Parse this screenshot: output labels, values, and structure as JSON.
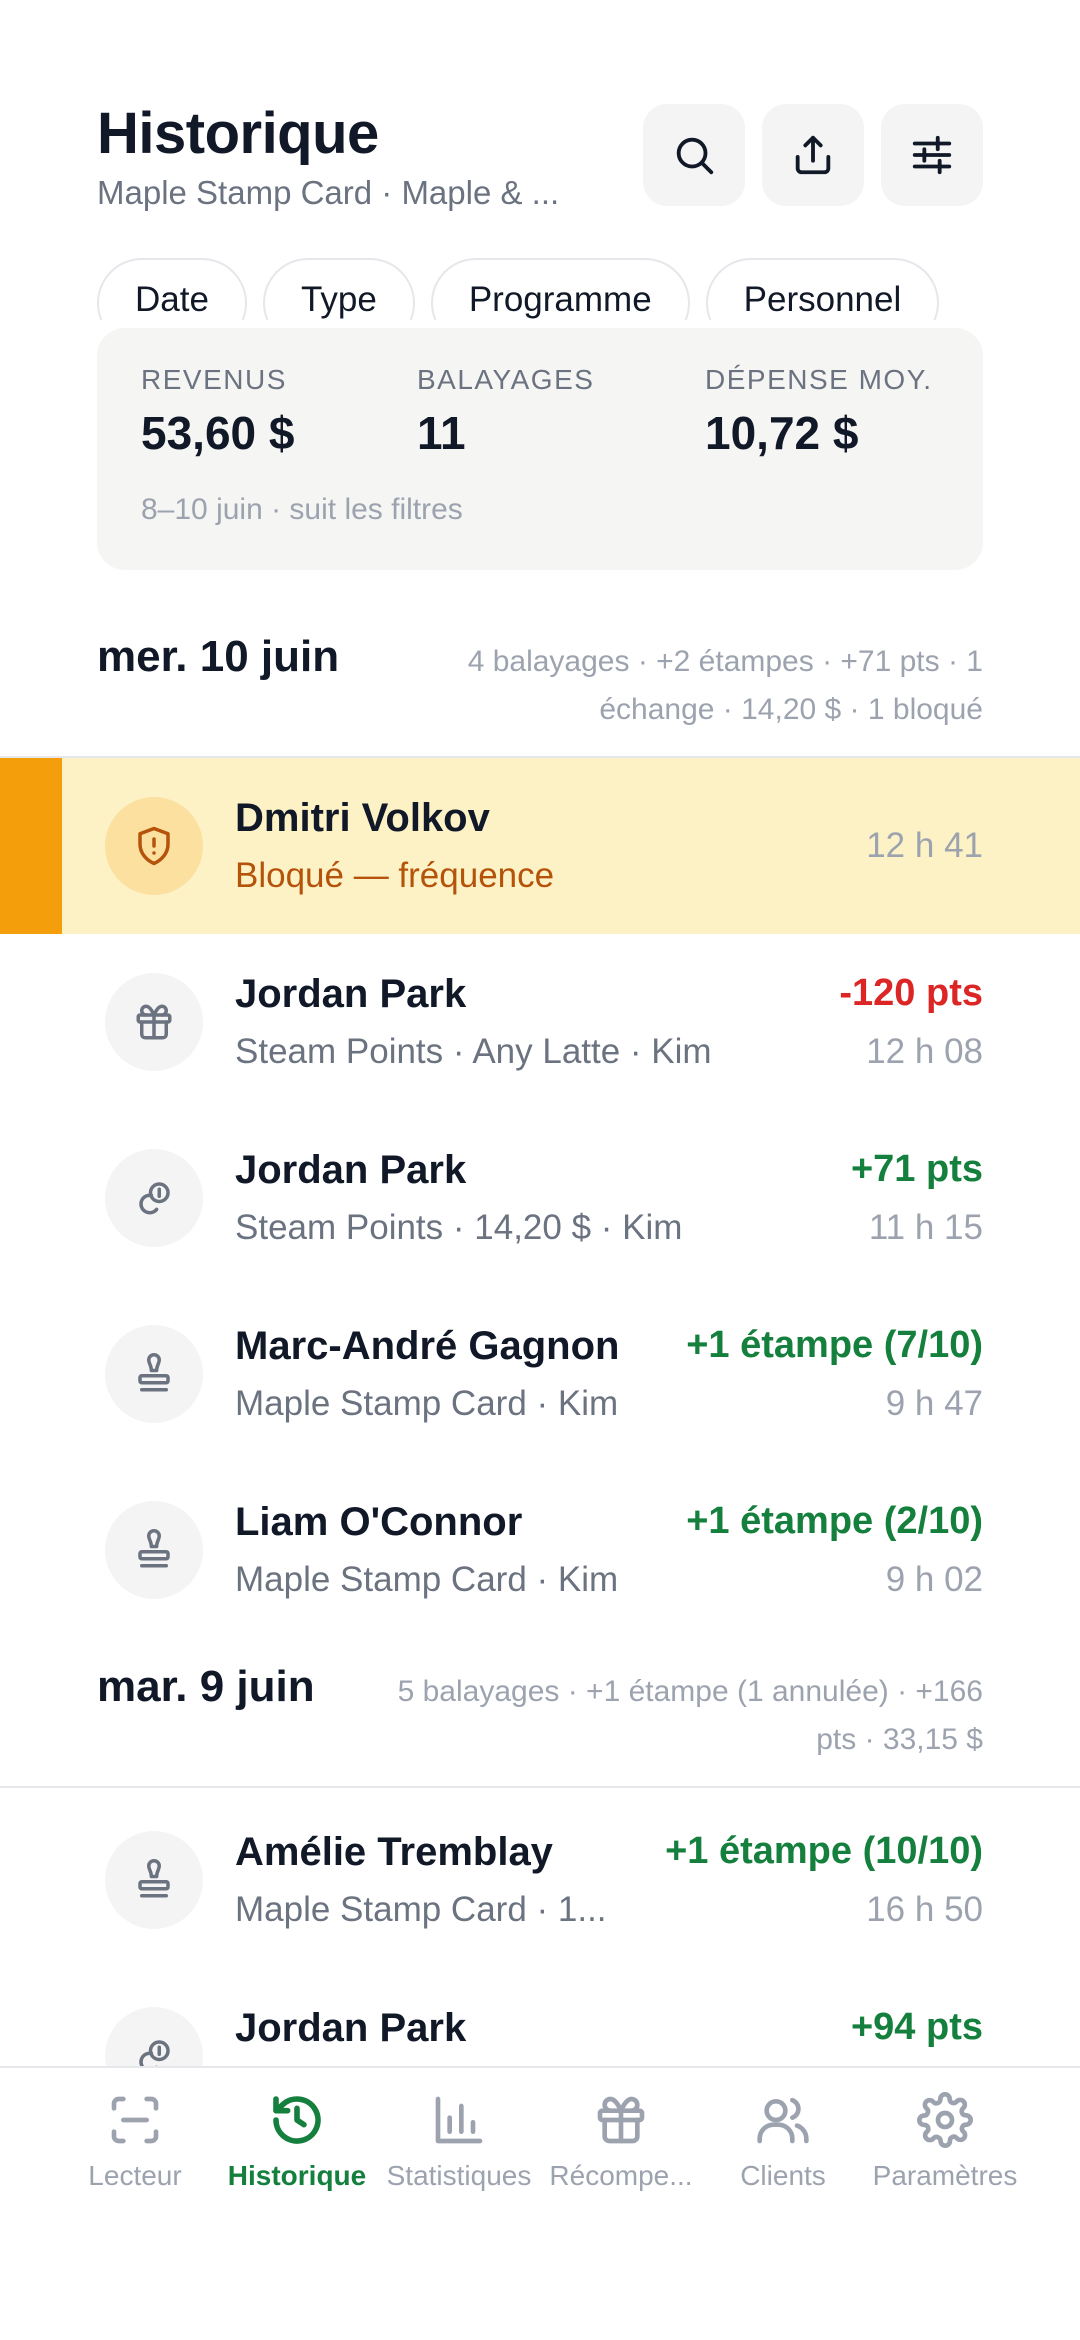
{
  "header": {
    "title": "Historique",
    "subtitle": "Maple Stamp Card · Maple & ..."
  },
  "filters": [
    "Date",
    "Type",
    "Programme",
    "Personnel"
  ],
  "summary": {
    "revenue_label": "REVENUS",
    "revenue_value": "53,60 $",
    "swipes_label": "BALAYAGES",
    "swipes_value": "11",
    "avg_label": "DÉPENSE MOY.",
    "avg_value": "10,72 $",
    "note": "8–10 juin · suit les filtres"
  },
  "days": [
    {
      "title": "mer. 10 juin",
      "summary_line1": "4 balayages · +2 étampes · +71 pts · 1",
      "summary_line2": "échange · 14,20 $ · 1 bloqué",
      "entries": [
        {
          "name": "Dmitri Volkov",
          "detail": "Bloqué — fréquence",
          "amount": "",
          "time": "12 h 41",
          "icon": "shield-alert-icon",
          "status": "blocked"
        },
        {
          "name": "Jordan Park",
          "detail": "Steam Points · Any Latte · Kim",
          "amount": "-120 pts",
          "time": "12 h 08",
          "icon": "gift-icon",
          "status": "negative"
        },
        {
          "name": "Jordan Park",
          "detail": "Steam Points · 14,20 $ · Kim",
          "amount": "+71 pts",
          "time": "11 h 15",
          "icon": "coins-icon",
          "status": "positive"
        },
        {
          "name": "Marc-André Gagnon",
          "detail": "Maple Stamp Card · Kim",
          "amount": "+1 étampe (7/10)",
          "time": "9 h 47",
          "icon": "stamp-icon",
          "status": "positive"
        },
        {
          "name": "Liam O'Connor",
          "detail": "Maple Stamp Card · Kim",
          "amount": "+1 étampe (2/10)",
          "time": "9 h 02",
          "icon": "stamp-icon",
          "status": "positive"
        }
      ]
    },
    {
      "title": "mar. 9 juin",
      "summary_line1": "5 balayages · +1 étampe (1 annulée) · +166",
      "summary_line2": "pts · 33,15 $",
      "entries": [
        {
          "name": "Amélie Tremblay",
          "detail": "Maple Stamp Card · 1...",
          "amount": "+1 étampe (10/10)",
          "time": "16 h 50",
          "icon": "stamp-icon",
          "status": "positive"
        },
        {
          "name": "Jordan Park",
          "detail": "",
          "amount": "+94 pts",
          "time": "",
          "icon": "coins-icon",
          "status": "positive"
        }
      ]
    }
  ],
  "tabbar": {
    "items": [
      {
        "label": "Lecteur",
        "icon": "scan-icon"
      },
      {
        "label": "Historique",
        "icon": "history-icon",
        "active": true
      },
      {
        "label": "Statistiques",
        "icon": "bar-chart-icon"
      },
      {
        "label": "Récompe...",
        "icon": "gift-icon"
      },
      {
        "label": "Clients",
        "icon": "users-icon"
      },
      {
        "label": "Paramètres",
        "icon": "settings-icon"
      }
    ]
  },
  "colors": {
    "accent": "#15803d",
    "negative": "#dc2626",
    "blocked_bg": "#fdf2c6",
    "blocked_bar": "#f59e0b",
    "blocked_text": "#b45309"
  }
}
